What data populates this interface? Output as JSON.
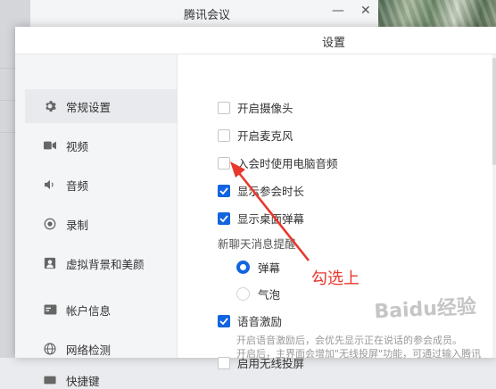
{
  "background_window": {
    "title": "腾讯会议",
    "minimize_glyph": "—",
    "close_glyph": "✕"
  },
  "dialog": {
    "title": "设置"
  },
  "sidebar": {
    "items": [
      {
        "label": "常规设置",
        "icon": "gear-icon",
        "active": true
      },
      {
        "label": "视频",
        "icon": "camera-icon",
        "active": false
      },
      {
        "label": "音频",
        "icon": "speaker-icon",
        "active": false
      },
      {
        "label": "录制",
        "icon": "record-icon",
        "active": false
      },
      {
        "label": "虚拟背景和美颜",
        "icon": "portrait-icon",
        "active": false
      },
      {
        "label": "帐户信息",
        "icon": "id-card-icon",
        "active": false
      },
      {
        "label": "网络检测",
        "icon": "globe-icon",
        "active": false
      },
      {
        "label": "快捷键",
        "icon": "keyboard-icon",
        "active": false
      }
    ]
  },
  "general": {
    "options": [
      {
        "label": "开启摄像头",
        "checked": false
      },
      {
        "label": "开启麦克风",
        "checked": false
      },
      {
        "label": "入会时使用电脑音频",
        "checked": false
      },
      {
        "label": "显示参会时长",
        "checked": true
      },
      {
        "label": "显示桌面弹幕",
        "checked": true
      }
    ],
    "chat_section_label": "新聊天消息提醒",
    "chat_options": [
      {
        "label": "弹幕",
        "selected": true
      },
      {
        "label": "气泡",
        "selected": false
      }
    ],
    "voice_incentive": {
      "label": "语音激励",
      "checked": true,
      "hint": "开启语音激励后，会优先显示正在说话的参会成员。"
    },
    "wireless_projection": {
      "label": "启用无线投屏",
      "checked": false,
      "hint": "开启后，主界面会增加\"无线投屏\"功能，可通过输入腾讯"
    }
  },
  "annotation": {
    "text": "勾选上",
    "color": "#e8372d"
  },
  "watermark": {
    "text": "Baidu经验"
  },
  "colors": {
    "accent": "#1264e0",
    "sidebar_bg": "#f4f5f7"
  }
}
